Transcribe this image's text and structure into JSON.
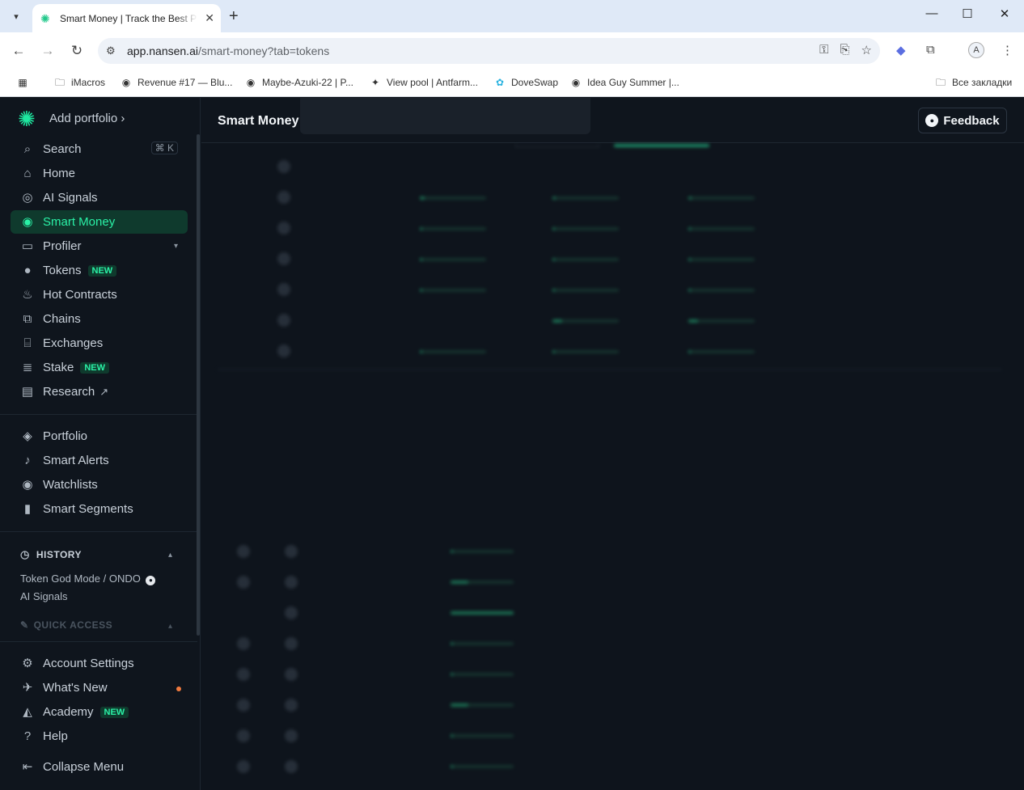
{
  "browser": {
    "tab_title": "Smart Money | Track the Best Performing Wallets",
    "url_host": "app.nansen.ai",
    "url_path": "/smart-money?tab=tokens",
    "bookmarks": [
      {
        "label": "iMacros"
      },
      {
        "label": "Revenue #17 — Blu..."
      },
      {
        "label": "Maybe-Azuki-22 | P..."
      },
      {
        "label": "View pool | Antfarm..."
      },
      {
        "label": "DoveSwap"
      },
      {
        "label": "Idea Guy Summer |..."
      },
      {
        "label": "Все закладки"
      }
    ],
    "profile_initial": "A"
  },
  "sidebar": {
    "add_portfolio": "Add portfolio ›",
    "search": {
      "label": "Search",
      "shortcut": "⌘ K"
    },
    "items": [
      {
        "label": "Home"
      },
      {
        "label": "AI Signals"
      },
      {
        "label": "Smart Money"
      },
      {
        "label": "Profiler"
      },
      {
        "label": "Tokens",
        "badge": "NEW"
      },
      {
        "label": "Hot Contracts"
      },
      {
        "label": "Chains"
      },
      {
        "label": "Exchanges"
      },
      {
        "label": "Stake",
        "badge": "NEW"
      },
      {
        "label": "Research"
      }
    ],
    "items2": [
      {
        "label": "Portfolio"
      },
      {
        "label": "Smart Alerts"
      },
      {
        "label": "Watchlists"
      },
      {
        "label": "Smart Segments"
      }
    ],
    "history_title": "HISTORY",
    "history": [
      "Token God Mode / ONDO",
      "AI Signals"
    ],
    "quick_access": "QUICK ACCESS",
    "bottom": [
      {
        "label": "Account Settings"
      },
      {
        "label": "What's New"
      },
      {
        "label": "Academy",
        "badge": "NEW"
      },
      {
        "label": "Help"
      },
      {
        "label": "Collapse Menu"
      }
    ]
  },
  "header": {
    "title": "Smart Money",
    "feedback": "Feedback"
  },
  "colors": {
    "accent": "#2af1a6",
    "bg": "#0e141c"
  }
}
